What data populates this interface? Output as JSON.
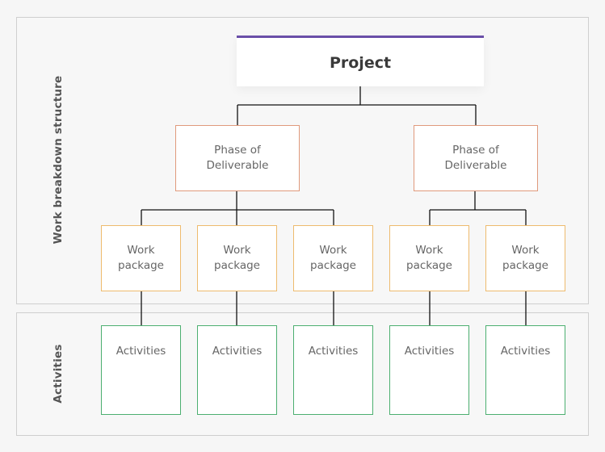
{
  "diagram": {
    "sections": {
      "wbs_label": "Work breakdown structure",
      "activities_label": "Activities"
    },
    "project": {
      "label": "Project"
    },
    "phases": [
      {
        "label": "Phase of\nDeliverable"
      },
      {
        "label": "Phase of\nDeliverable"
      }
    ],
    "work_packages": [
      {
        "label": "Work\npackage",
        "phase": 0
      },
      {
        "label": "Work\npackage",
        "phase": 0
      },
      {
        "label": "Work\npackage",
        "phase": 0
      },
      {
        "label": "Work\npackage",
        "phase": 1
      },
      {
        "label": "Work\npackage",
        "phase": 1
      }
    ],
    "activities": [
      {
        "label": "Activities",
        "work_package": 0
      },
      {
        "label": "Activities",
        "work_package": 1
      },
      {
        "label": "Activities",
        "work_package": 2
      },
      {
        "label": "Activities",
        "work_package": 3
      },
      {
        "label": "Activities",
        "work_package": 4
      }
    ],
    "colors": {
      "project_accent": "#6a4fa8",
      "phase_border": "#e09a7c",
      "work_package_border": "#eebb6e",
      "activity_border": "#4caf70",
      "connector": "#111111"
    }
  }
}
